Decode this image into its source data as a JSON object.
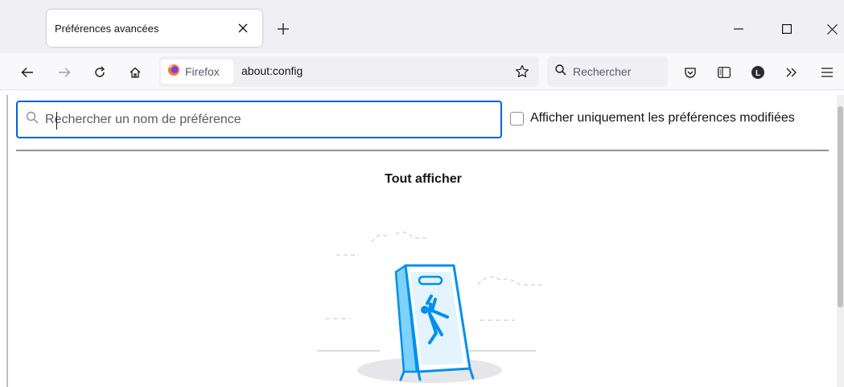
{
  "tab": {
    "title": "Préférences avancées"
  },
  "urlbar": {
    "identity": "Firefox",
    "url": "about:config"
  },
  "searchbar": {
    "placeholder": "Rechercher"
  },
  "account": {
    "initial": "L"
  },
  "config": {
    "search_placeholder": "Rechercher un nom de préférence",
    "modified_only_label": "Afficher uniquement les préférences modifiées",
    "show_all": "Tout afficher"
  },
  "colors": {
    "accent": "#0061e0",
    "illustration": "#0090ed",
    "firefox_orange": "#ff7139"
  }
}
